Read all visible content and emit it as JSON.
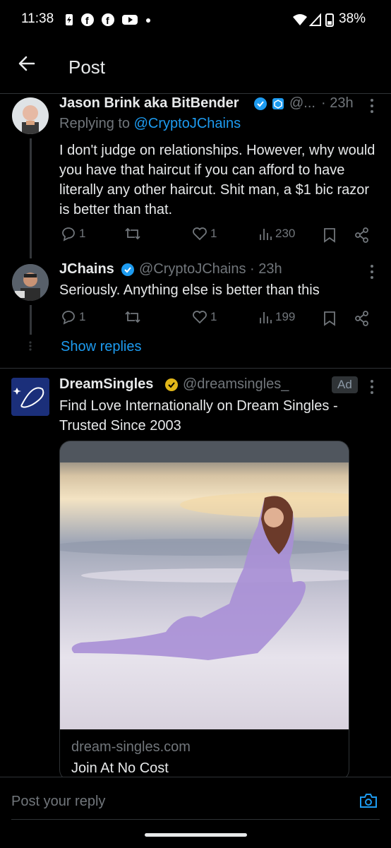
{
  "status_bar": {
    "time": "11:38",
    "battery": "38%"
  },
  "header": {
    "title": "Post"
  },
  "tweet1": {
    "name": "Jason Brink aka BitBender",
    "handle": "@...",
    "time": "· 23h",
    "reply_prefix": "Replying to",
    "reply_to": "@CryptoJChains",
    "text": "I don't judge on relationships. However, why would you have that haircut if you can afford to have literally any other haircut. Shit man, a $1 bic razor is better than that.",
    "replies": "1",
    "likes": "1",
    "views": "230"
  },
  "tweet2": {
    "name": "JChains",
    "handle": "@CryptoJChains · 23h",
    "text": "Seriously. Anything else is better than this",
    "replies": "1",
    "likes": "1",
    "views": "199"
  },
  "show_replies": "Show replies",
  "ad": {
    "name": "DreamSingles",
    "handle": "@dreamsingles_",
    "badge": "Ad",
    "text": "Find Love Internationally on Dream Singles - Trusted Since 2003",
    "card_domain": "dream-singles.com",
    "card_title": "Join At No Cost"
  },
  "reply_bar": {
    "placeholder": "Post your reply"
  },
  "colors": {
    "accent": "#1d9bf0",
    "verified_gold": "#e2b719",
    "background": "#000000"
  }
}
